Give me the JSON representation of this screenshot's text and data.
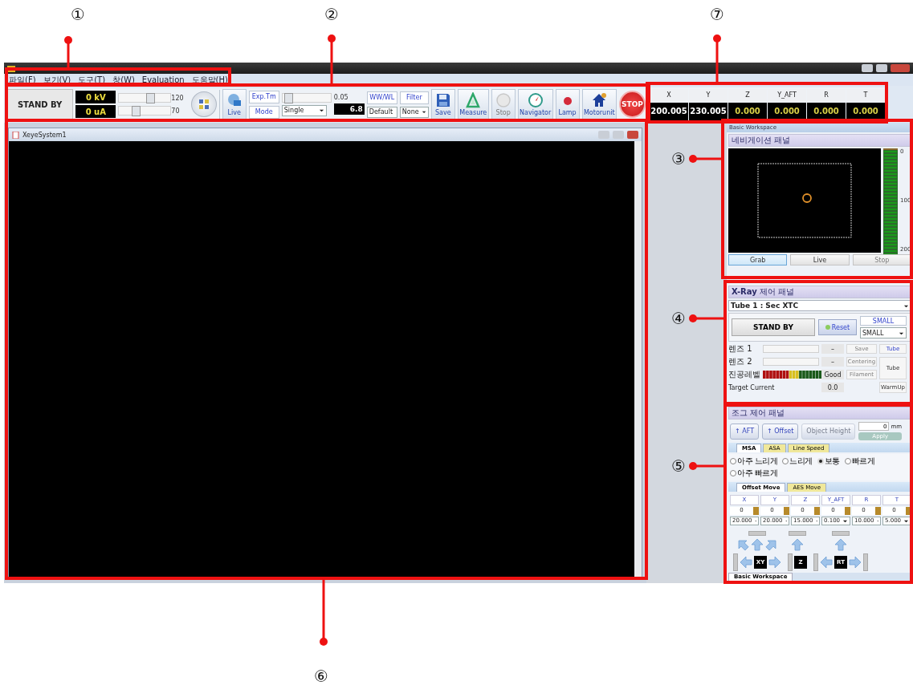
{
  "callouts": [
    {
      "number": "①"
    },
    {
      "number": "②"
    },
    {
      "number": "③"
    },
    {
      "number": "④"
    },
    {
      "number": "⑤"
    },
    {
      "number": "⑥"
    },
    {
      "number": "⑦"
    }
  ],
  "menu": [
    "파일(F)",
    "보기(V)",
    "도구(T)",
    "창(W)",
    "Evaluation",
    "도움말(H)"
  ],
  "toolbar": {
    "status": "STAND BY",
    "kv": "0 kV",
    "ua": "0 uA",
    "sliders": [
      {
        "level": 0.63,
        "value": "120"
      },
      {
        "level": 0.3,
        "value": "70"
      }
    ],
    "live": "Live",
    "exp_button": "Exp.Tm",
    "mode_button": "Mode",
    "exp_slider": {
      "level": 0.05,
      "value": "0.05"
    },
    "mode_select": "Single",
    "frame_value": "6.8",
    "wwwl_button": "WW/WL",
    "filter_button": "Filter",
    "wwwl_select": "Default",
    "filter_select": "None",
    "tools": [
      {
        "kind": "save",
        "label": "Save",
        "disabled": false
      },
      {
        "kind": "measure",
        "label": "Measure",
        "disabled": false
      },
      {
        "kind": "stop",
        "label": "Stop",
        "disabled": true
      },
      {
        "kind": "navigator",
        "label": "Navigator",
        "disabled": false
      },
      {
        "kind": "lamp",
        "label": "Lamp",
        "disabled": false
      },
      {
        "kind": "motor",
        "label": "Motorunit",
        "disabled": false
      }
    ],
    "stop": "STOP"
  },
  "coords": [
    {
      "axis": "X",
      "value": "200.005",
      "color": "#ffffff"
    },
    {
      "axis": "Y",
      "value": "230.005",
      "color": "#ffffff"
    },
    {
      "axis": "Z",
      "value": "0.000",
      "color": "#d8d048"
    },
    {
      "axis": "Y_AFT",
      "value": "0.000",
      "color": "#d8d048"
    },
    {
      "axis": "R",
      "value": "0.000",
      "color": "#d8d048"
    },
    {
      "axis": "T",
      "value": "0.000",
      "color": "#d8d048"
    }
  ],
  "document": {
    "title": "XeyeSystem1"
  },
  "dock": {
    "title": "Basic Workspace",
    "nav": {
      "title": "네비게이션 패널",
      "scale": [
        "0",
        "100",
        "200"
      ],
      "buttons": [
        {
          "label": "Grab",
          "selected": true,
          "disabled": false
        },
        {
          "label": "Live",
          "selected": false,
          "disabled": false
        },
        {
          "label": "Stop",
          "selected": false,
          "disabled": true
        }
      ]
    },
    "xray": {
      "title": "**X-Ray** 제어 패널",
      "tube_select": "Tube 1 : Sec XTC",
      "status": "STAND BY",
      "reset": "Reset",
      "size_label": "SMALL",
      "size_select": "SMALL",
      "lenses": [
        {
          "label": "렌즈 1",
          "reading": "–"
        },
        {
          "label": "렌즈 2",
          "reading": "–"
        }
      ],
      "vacuum": {
        "label": "진공레벨",
        "reading": "Good"
      },
      "target": {
        "label": "Target Current",
        "reading": "0.0"
      },
      "buttons": [
        {
          "label": "Save",
          "disabled": true
        },
        {
          "label": "Centering",
          "disabled": true
        },
        {
          "label": "Filament",
          "disabled": true
        }
      ],
      "tube_link": "Tube",
      "tube_button": "Tube",
      "warmup": "WarmUp"
    },
    "jog": {
      "title": "조그 제어 패널",
      "aft": "↑ AFT",
      "offset": "↑ Offset",
      "object_height": "Object Height",
      "height_value": "0",
      "unit": "mm",
      "apply": "Apply",
      "speed_tabs": [
        {
          "label": "MSA",
          "selected": true
        },
        {
          "label": "ASA",
          "selected": false
        },
        {
          "label": "Line Speed",
          "selected": false
        }
      ],
      "speeds": [
        {
          "label": "아주 느리게",
          "selected": false
        },
        {
          "label": "느리게",
          "selected": false
        },
        {
          "label": "보통",
          "selected": true
        },
        {
          "label": "빠르게",
          "selected": false
        },
        {
          "label": "아주 빠르게",
          "selected": false
        }
      ],
      "move_tabs": [
        {
          "label": "Offset Move",
          "selected": true
        },
        {
          "label": "AES Move",
          "selected": false
        }
      ],
      "axes": [
        {
          "axis": "X",
          "value": "0",
          "step": "20.000"
        },
        {
          "axis": "Y",
          "value": "0",
          "step": "20.000"
        },
        {
          "axis": "Z",
          "value": "0",
          "step": "15.000"
        },
        {
          "axis": "Y_AFT",
          "value": "0",
          "step": "0.100"
        },
        {
          "axis": "R",
          "value": "0",
          "step": "10.000"
        },
        {
          "axis": "T",
          "value": "0",
          "step": "5.000"
        }
      ],
      "pads": [
        "XY",
        "Z",
        "RT"
      ]
    },
    "tabs": [
      {
        "label": "Basic Workspace",
        "selected": true
      }
    ]
  }
}
